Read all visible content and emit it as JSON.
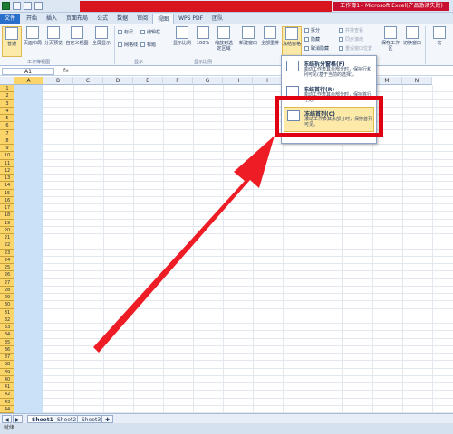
{
  "titlebar": {
    "title": "工作簿1 - Microsoft Excel(产品激活失败)"
  },
  "tabs": [
    "文件",
    "开始",
    "插入",
    "页面布局",
    "公式",
    "数据",
    "审阅",
    "视图",
    "WPS PDF",
    "团队"
  ],
  "ribbon": {
    "buttons": [
      "普通",
      "页面布局",
      "分页预览",
      "自定义视图",
      "全屏显示",
      "显示比例",
      "100%",
      "缩放到选定区域",
      "新建窗口",
      "全部重排",
      "冻结窗格",
      "保存工作区",
      "切换窗口",
      "宏"
    ],
    "checks": [
      "标尺",
      "编辑栏",
      "网格线",
      "标题"
    ],
    "small": [
      "拆分",
      "隐藏",
      "取消隐藏",
      "并排查看",
      "同步滚动",
      "重设窗口位置"
    ],
    "groups": [
      "工作簿视图",
      "显示",
      "显示比例"
    ]
  },
  "formula": {
    "name_box": "A1",
    "fx": "fx"
  },
  "columns": [
    "A",
    "B",
    "C",
    "D",
    "E",
    "F",
    "G",
    "H",
    "I",
    "J",
    "K",
    "L",
    "M",
    "N"
  ],
  "rows": [
    "1",
    "2",
    "3",
    "4",
    "5",
    "6",
    "7",
    "8",
    "9",
    "10",
    "11",
    "12",
    "13",
    "14",
    "15",
    "16",
    "17",
    "18",
    "19",
    "20",
    "21",
    "22",
    "23",
    "24",
    "25",
    "26",
    "27",
    "28",
    "29",
    "30",
    "31",
    "32",
    "33",
    "34",
    "35",
    "36",
    "37",
    "38",
    "39",
    "40",
    "41",
    "42",
    "43",
    "44"
  ],
  "dropdown": {
    "items": [
      {
        "title": "冻结拆分窗格(F)",
        "desc": "滚动工作表其余部分时，保持行和列可见(基于当前的选择)。"
      },
      {
        "title": "冻结首行(R)",
        "desc": "滚动工作表其余部分时，保持首行可见。"
      },
      {
        "title": "冻结首列(C)",
        "desc": "滚动工作表其余部分时，保持首列可见。"
      }
    ]
  },
  "sheets": [
    "Sheet1",
    "Sheet2",
    "Sheet3"
  ],
  "status": "就绪",
  "colors": {
    "highlight": "#e00012",
    "selection": "#cbe1f7",
    "row_header": "#fbd56a"
  }
}
